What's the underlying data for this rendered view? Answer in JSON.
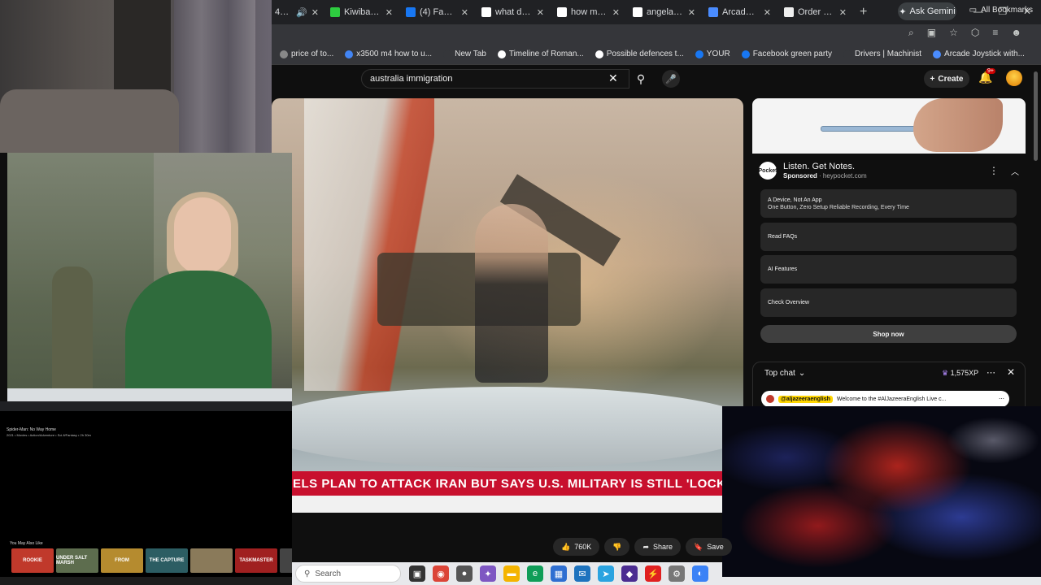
{
  "browser": {
    "tabs": [
      {
        "label": "Kiwibank Inter...",
        "color": "#2ecc40"
      },
      {
        "label": "(4) Facebook",
        "color": "#1877f2"
      },
      {
        "label": "what does m",
        "color": "#ffffff"
      },
      {
        "label": "how many c",
        "color": "#ffffff"
      },
      {
        "label": "angelawalsh",
        "color": "#ffffff"
      },
      {
        "label": "Arcade Joys",
        "color": "#4a8cff"
      },
      {
        "label": "Order New",
        "color": "#eeeeee"
      }
    ],
    "first_tab_fragment": "449)",
    "new_tab": "+",
    "ask_gemini": "Ask Gemini"
  },
  "bookmarks": [
    {
      "label": "price of to...",
      "color": "#888888"
    },
    {
      "label": "x3500 m4 how to u...",
      "color": "#4285f4"
    },
    {
      "label": "New Tab",
      "color": "#35363a"
    },
    {
      "label": "Timeline of Roman...",
      "color": "#ffffff"
    },
    {
      "label": "Possible defences t...",
      "color": "#ffffff"
    },
    {
      "label": "YOUR",
      "color": "#1877f2"
    },
    {
      "label": "Facebook green party",
      "color": "#1877f2"
    },
    {
      "label": "Drivers | Machinist",
      "color": "#35363a"
    },
    {
      "label": "Arcade Joystick with...",
      "color": "#4a8cff"
    }
  ],
  "all_bookmarks": "All Bookmarks",
  "youtube": {
    "search_value": "australia immigration",
    "create_label": "Create",
    "notif_count": "9+"
  },
  "video": {
    "ticker": "ELS PLAN TO ATTACK IRAN BUT SAYS U.S. MILITARY IS STILL 'LOCKED A"
  },
  "actions": {
    "likes": "760K",
    "share": "Share",
    "save": "Save"
  },
  "ad": {
    "logo": "Pocket",
    "title": "Listen. Get Notes.",
    "sponsored": "Sponsored",
    "domain": "heypocket.com",
    "rows": [
      {
        "line1": "A Device, Not An App",
        "line2": "One Button, Zero Setup Reliable Recording, Every Time"
      },
      {
        "line1": "Read FAQs",
        "line2": ""
      },
      {
        "line1": "AI Features",
        "line2": ""
      },
      {
        "line1": "Check Overview",
        "line2": ""
      }
    ],
    "shop_now": "Shop now"
  },
  "chat": {
    "title": "Top chat",
    "xp": "1,575XP",
    "pinned_channel": "@aljazeeraenglish",
    "pinned_text": "Welcome to the #AlJazeeraEnglish Live c..."
  },
  "mini": {
    "title": "Spider-Man: No Way Home",
    "meta": "2021 • Movies • Action/Adventure • Sci-fi/Fantasy • 2h 30m",
    "may_also": "You May Also Like",
    "posters": [
      {
        "label": "ROOKIE",
        "color": "#c0392b"
      },
      {
        "label": "UNDER SALT MARSH",
        "color": "#5d6d4e"
      },
      {
        "label": "FROM",
        "color": "#b58b2f"
      },
      {
        "label": "THE CAPTURE",
        "color": "#2c5d63"
      },
      {
        "label": "",
        "color": "#8a7a5a"
      },
      {
        "label": "TASKMASTER",
        "color": "#a02020"
      },
      {
        "label": "",
        "color": "#444444"
      }
    ]
  },
  "taskbar": {
    "search": "Search",
    "icons": [
      {
        "name": "task-view-icon",
        "color": "#333333",
        "glyph": "▣"
      },
      {
        "name": "chrome-icon",
        "color": "#db4437",
        "glyph": "◉"
      },
      {
        "name": "app-icon",
        "color": "#555555",
        "glyph": "●"
      },
      {
        "name": "copilot-icon",
        "color": "#7e57c2",
        "glyph": "✦"
      },
      {
        "name": "file-explorer-icon",
        "color": "#f4b400",
        "glyph": "▬"
      },
      {
        "name": "edge-icon",
        "color": "#0f9d58",
        "glyph": "e"
      },
      {
        "name": "store-icon",
        "color": "#2f6fd1",
        "glyph": "▦"
      },
      {
        "name": "outlook-icon",
        "color": "#1e73be",
        "glyph": "✉"
      },
      {
        "name": "telegram-icon",
        "color": "#2aa3e0",
        "glyph": "➤"
      },
      {
        "name": "app-purple-icon",
        "color": "#4b2c91",
        "glyph": "◆"
      },
      {
        "name": "app-red-icon",
        "color": "#e02020",
        "glyph": "⚡"
      },
      {
        "name": "settings-icon",
        "color": "#777777",
        "glyph": "⚙"
      },
      {
        "name": "app-blue-icon",
        "color": "#3b82f6",
        "glyph": "◐"
      }
    ]
  }
}
